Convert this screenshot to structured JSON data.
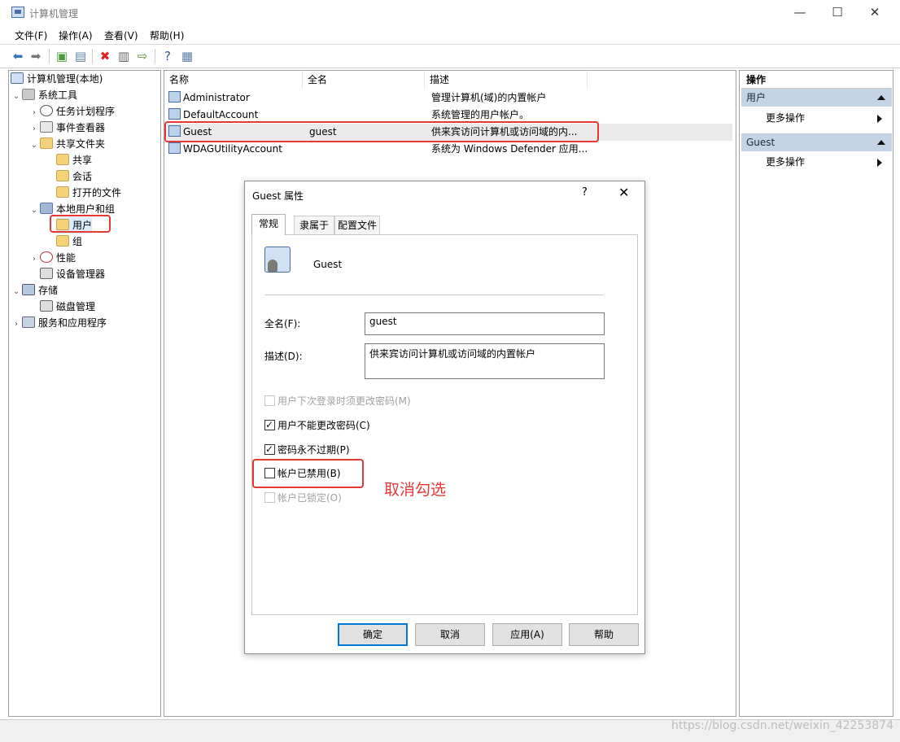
{
  "window": {
    "title": "计算机管理",
    "controls": {
      "minimize": "—",
      "maximize": "☐",
      "close": "✕"
    }
  },
  "menu": [
    "文件(F)",
    "操作(A)",
    "查看(V)",
    "帮助(H)"
  ],
  "tree": [
    {
      "label": "计算机管理(本地)",
      "icon": "computer-icon"
    },
    {
      "label": "系统工具",
      "icon": "tools-icon",
      "expanded": true
    },
    {
      "label": "任务计划程序",
      "icon": "clock-icon"
    },
    {
      "label": "事件查看器",
      "icon": "event-viewer-icon"
    },
    {
      "label": "共享文件夹",
      "icon": "shared-folder-icon",
      "expanded": true
    },
    {
      "label": "共享",
      "icon": "share-icon"
    },
    {
      "label": "会话",
      "icon": "session-icon"
    },
    {
      "label": "打开的文件",
      "icon": "open-file-icon"
    },
    {
      "label": "本地用户和组",
      "icon": "users-groups-icon",
      "expanded": true
    },
    {
      "label": "用户",
      "icon": "folder-icon",
      "selected": true
    },
    {
      "label": "组",
      "icon": "folder-icon"
    },
    {
      "label": "性能",
      "icon": "performance-icon"
    },
    {
      "label": "设备管理器",
      "icon": "device-manager-icon"
    },
    {
      "label": "存储",
      "icon": "storage-icon",
      "expanded": true
    },
    {
      "label": "磁盘管理",
      "icon": "disk-icon"
    },
    {
      "label": "服务和应用程序",
      "icon": "services-icon"
    }
  ],
  "list": {
    "columns": [
      "名称",
      "全名",
      "描述"
    ],
    "rows": [
      {
        "name": "Administrator",
        "fullname": "",
        "description": "管理计算机(域)的内置帐户"
      },
      {
        "name": "DefaultAccount",
        "fullname": "",
        "description": "系统管理的用户帐户。"
      },
      {
        "name": "Guest",
        "fullname": "guest",
        "description": "供来宾访问计算机或访问域的内...",
        "selected": true
      },
      {
        "name": "WDAGUtilityAccount",
        "fullname": "",
        "description": "系统为 Windows Defender 应用..."
      }
    ]
  },
  "actions": {
    "title": "操作",
    "sections": [
      {
        "title": "用户",
        "item": "更多操作"
      },
      {
        "title": "Guest",
        "item": "更多操作"
      }
    ]
  },
  "dialog": {
    "title": "Guest 属性",
    "help": "?",
    "close": "✕",
    "tabs": [
      "常规",
      "隶属于",
      "配置文件"
    ],
    "active_tab": "常规",
    "username": "Guest",
    "fullname_label": "全名(F):",
    "fullname_value": "guest",
    "description_label": "描述(D):",
    "description_value": "供来宾访问计算机或访问域的内置帐户",
    "checkboxes": [
      {
        "label": "用户下次登录时须更改密码(M)",
        "checked": false,
        "disabled": true
      },
      {
        "label": "用户不能更改密码(C)",
        "checked": true,
        "disabled": false
      },
      {
        "label": "密码永不过期(P)",
        "checked": true,
        "disabled": false
      },
      {
        "label": "帐户已禁用(B)",
        "checked": false,
        "disabled": false
      },
      {
        "label": "帐户已锁定(O)",
        "checked": false,
        "disabled": true
      }
    ],
    "buttons": [
      "确定",
      "取消",
      "应用(A)",
      "帮助"
    ]
  },
  "annotation": "取消勾选",
  "watermark": "https://blog.csdn.net/weixin_42253874"
}
